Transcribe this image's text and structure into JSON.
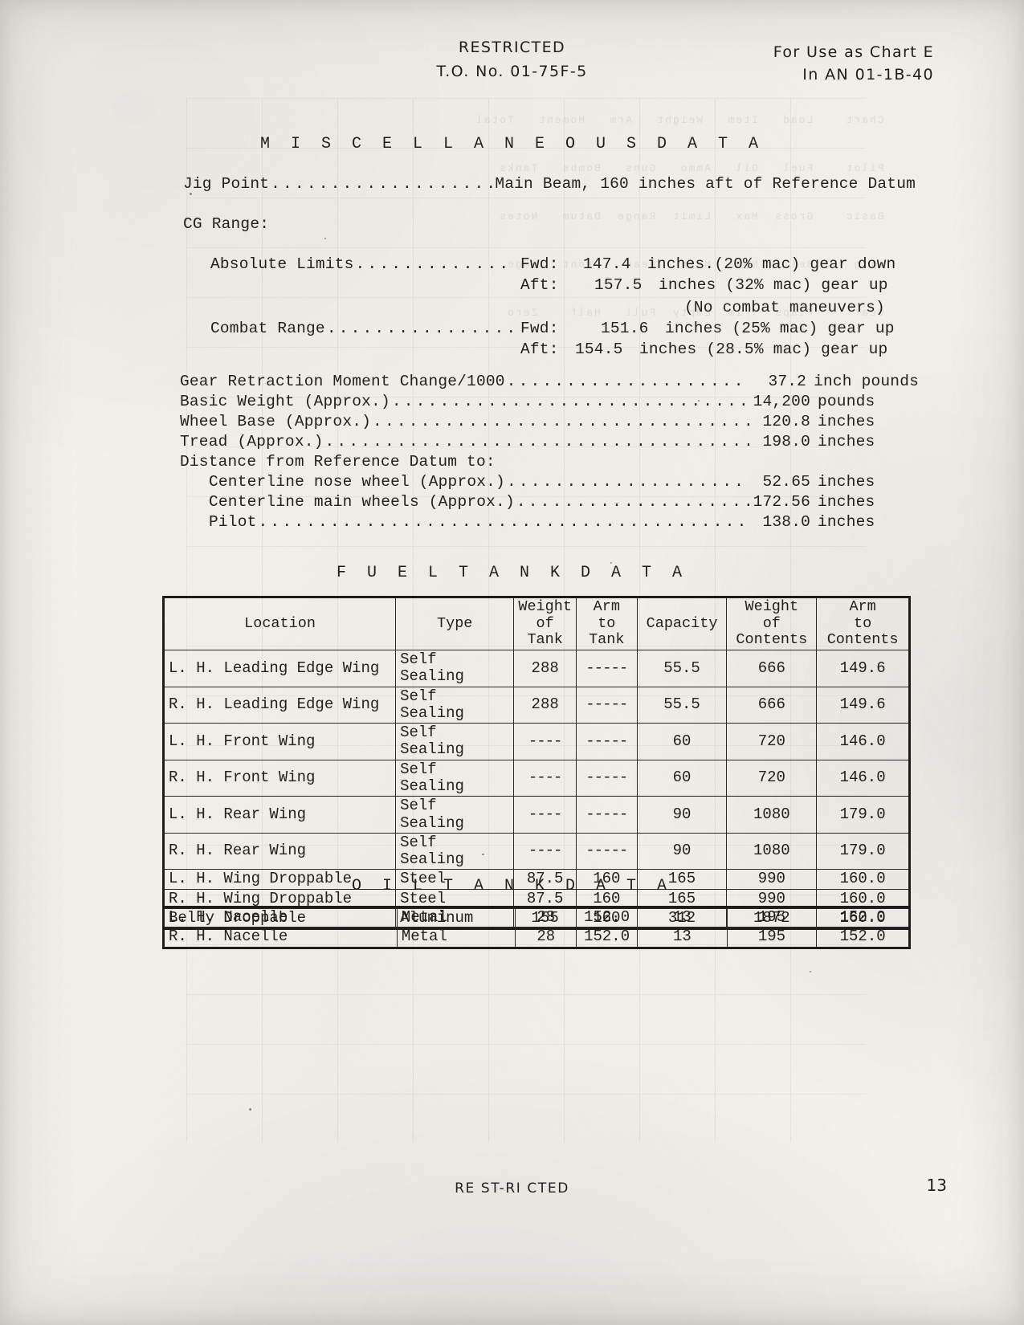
{
  "header": {
    "classification": "RESTRICTED",
    "document_number": "T.O. No. 01-75F-5",
    "chart_note_line1": "For Use as Chart E",
    "chart_note_line2": "In AN 01-1B-40"
  },
  "misc": {
    "title": "M I S C E L L A N E O U S    D A T A",
    "jig_point": {
      "label": "Jig Point",
      "value": "Main Beam, 160 inches aft of Reference Datum"
    },
    "cg_range_label": "CG Range:",
    "cg_rows": [
      {
        "label": "Absolute Limits",
        "dir": "Fwd:",
        "value": "147.4",
        "text": "inches.(20% mac) gear down"
      },
      {
        "label": "",
        "dir": "Aft:",
        "value": "157.5",
        "text": "inches (32% mac) gear up"
      },
      {
        "label": "",
        "dir": "",
        "value": "",
        "text": "(No combat maneuvers)"
      },
      {
        "label": "Combat Range",
        "dir": "Fwd:",
        "value": "151.6",
        "text": "inches (25% mac) gear up"
      },
      {
        "label": "",
        "dir": "Aft:",
        "value": "154.5",
        "text": "inches (28.5% mac) gear up"
      }
    ],
    "measurements": [
      {
        "label": "Gear Retraction Moment Change/1000",
        "value": "37.2",
        "unit": "inch pounds"
      },
      {
        "label": "Basic Weight (Approx.)",
        "value": "14,200",
        "unit": "pounds"
      },
      {
        "label": "Wheel Base (Approx.)",
        "value": "120.8",
        "unit": "inches"
      },
      {
        "label": "Tread (Approx.)",
        "value": "198.0",
        "unit": "inches"
      }
    ],
    "datum_heading": "Distance from Reference Datum to:",
    "datum_rows": [
      {
        "label": "Centerline nose wheel (Approx.)",
        "value": "52.65",
        "unit": "inches"
      },
      {
        "label": "Centerline main wheels (Approx.)",
        "value": "172.56",
        "unit": "inches"
      },
      {
        "label": "Pilot",
        "value": "138.0",
        "unit": "inches"
      }
    ]
  },
  "fuel_tank": {
    "title": "F U E L    T A N K    D A T A",
    "columns": [
      {
        "l1": "",
        "l2": "Location",
        "l3": ""
      },
      {
        "l1": "",
        "l2": "Type",
        "l3": ""
      },
      {
        "l1": "Weight",
        "l2": "of",
        "l3": "Tank"
      },
      {
        "l1": "Arm",
        "l2": "to",
        "l3": "Tank"
      },
      {
        "l1": "",
        "l2": "Capacity",
        "l3": ""
      },
      {
        "l1": "Weight",
        "l2": "of",
        "l3": "Contents"
      },
      {
        "l1": "Arm",
        "l2": "to",
        "l3": "Contents"
      }
    ],
    "rows": [
      {
        "location": "L. H. Leading Edge Wing",
        "type": "Self Sealing",
        "weight_tank": "288",
        "arm_tank": "-----",
        "capacity": "55.5",
        "weight_contents": "666",
        "arm_contents": "149.6"
      },
      {
        "location": "R. H. Leading Edge Wing",
        "type": "Self Sealing",
        "weight_tank": "288",
        "arm_tank": "-----",
        "capacity": "55.5",
        "weight_contents": "666",
        "arm_contents": "149.6"
      },
      {
        "location": "L. H. Front Wing",
        "type": "Self Sealing",
        "weight_tank": "----",
        "arm_tank": "-----",
        "capacity": "60",
        "weight_contents": "720",
        "arm_contents": "146.0"
      },
      {
        "location": "R. H. Front Wing",
        "type": "Self Sealing",
        "weight_tank": "----",
        "arm_tank": "-----",
        "capacity": "60",
        "weight_contents": "720",
        "arm_contents": "146.0"
      },
      {
        "location": "L. H. Rear Wing",
        "type": "Self Sealing",
        "weight_tank": "----",
        "arm_tank": "-----",
        "capacity": "90",
        "weight_contents": "1080",
        "arm_contents": "179.0"
      },
      {
        "location": "R. H. Rear Wing",
        "type": "Self Sealing",
        "weight_tank": "----",
        "arm_tank": "-----",
        "capacity": "90",
        "weight_contents": "1080",
        "arm_contents": "179.0"
      },
      {
        "location": "L. H. Wing Droppable",
        "type": "Steel",
        "weight_tank": "87.5",
        "arm_tank": "160",
        "capacity": "165",
        "weight_contents": "990",
        "arm_contents": "160.0"
      },
      {
        "location": "R. H. Wing Droppable",
        "type": "Steel",
        "weight_tank": "87.5",
        "arm_tank": "160",
        "capacity": "165",
        "weight_contents": "990",
        "arm_contents": "160.0"
      },
      {
        "location": "Belly Droppable",
        "type": "Aluminum",
        "weight_tank": "155",
        "arm_tank": "160",
        "capacity": "312",
        "weight_contents": "1872",
        "arm_contents": "160.0"
      }
    ]
  },
  "oil_tank": {
    "title": "O I L    T A N K    D A T A",
    "rows": [
      {
        "location": "L. H. Nacelle",
        "type": "Metal",
        "weight_tank": "28",
        "arm_tank": "152.0",
        "capacity": "13",
        "weight_contents": "195",
        "arm_contents": "152.0"
      },
      {
        "location": "R. H. Nacelle",
        "type": "Metal",
        "weight_tank": "28",
        "arm_tank": "152.0",
        "capacity": "13",
        "weight_contents": "195",
        "arm_contents": "152.0"
      }
    ]
  },
  "footer": {
    "classification": "RE ST-RI CTED",
    "page_number": "13"
  },
  "colors": {
    "paper": "#f3f1ec",
    "ink": "#23211d",
    "rule": "#1f1d1a"
  }
}
